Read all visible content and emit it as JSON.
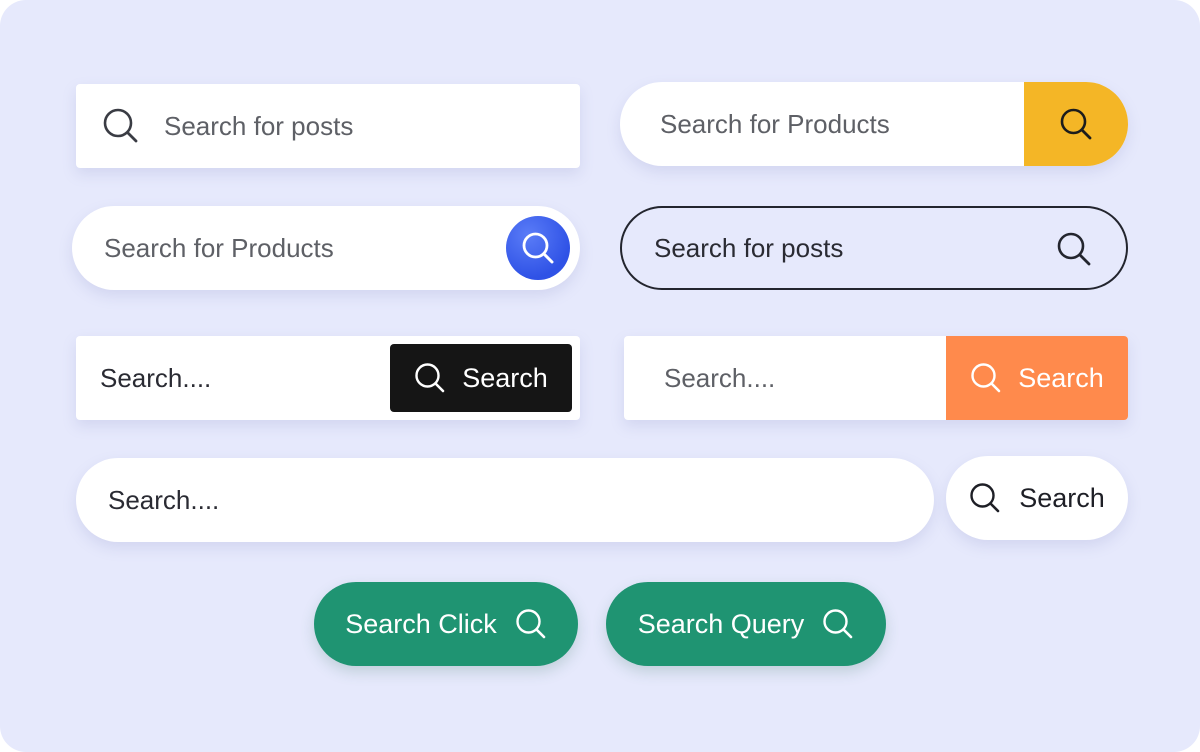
{
  "search_bars": {
    "bar1": {
      "placeholder": "Search for posts"
    },
    "bar2": {
      "placeholder": "Search for Products",
      "button_color": "#f4b626"
    },
    "bar3": {
      "placeholder": "Search for Products",
      "button_color": "#2f52e6"
    },
    "bar4": {
      "placeholder": "Search for posts"
    },
    "bar5": {
      "placeholder": "Search....",
      "button_label": "Search",
      "button_color": "#151515"
    },
    "bar6": {
      "placeholder": "Search....",
      "button_label": "Search",
      "button_color": "#ff8a4c"
    },
    "bar7": {
      "placeholder": "Search...."
    },
    "bar8": {
      "button_label": "Search"
    }
  },
  "green_buttons": {
    "click_label": "Search Click",
    "query_label": "Search Query",
    "color": "#1f9472"
  },
  "colors": {
    "background": "#e6e9fc"
  },
  "icons": [
    "search-icon"
  ]
}
